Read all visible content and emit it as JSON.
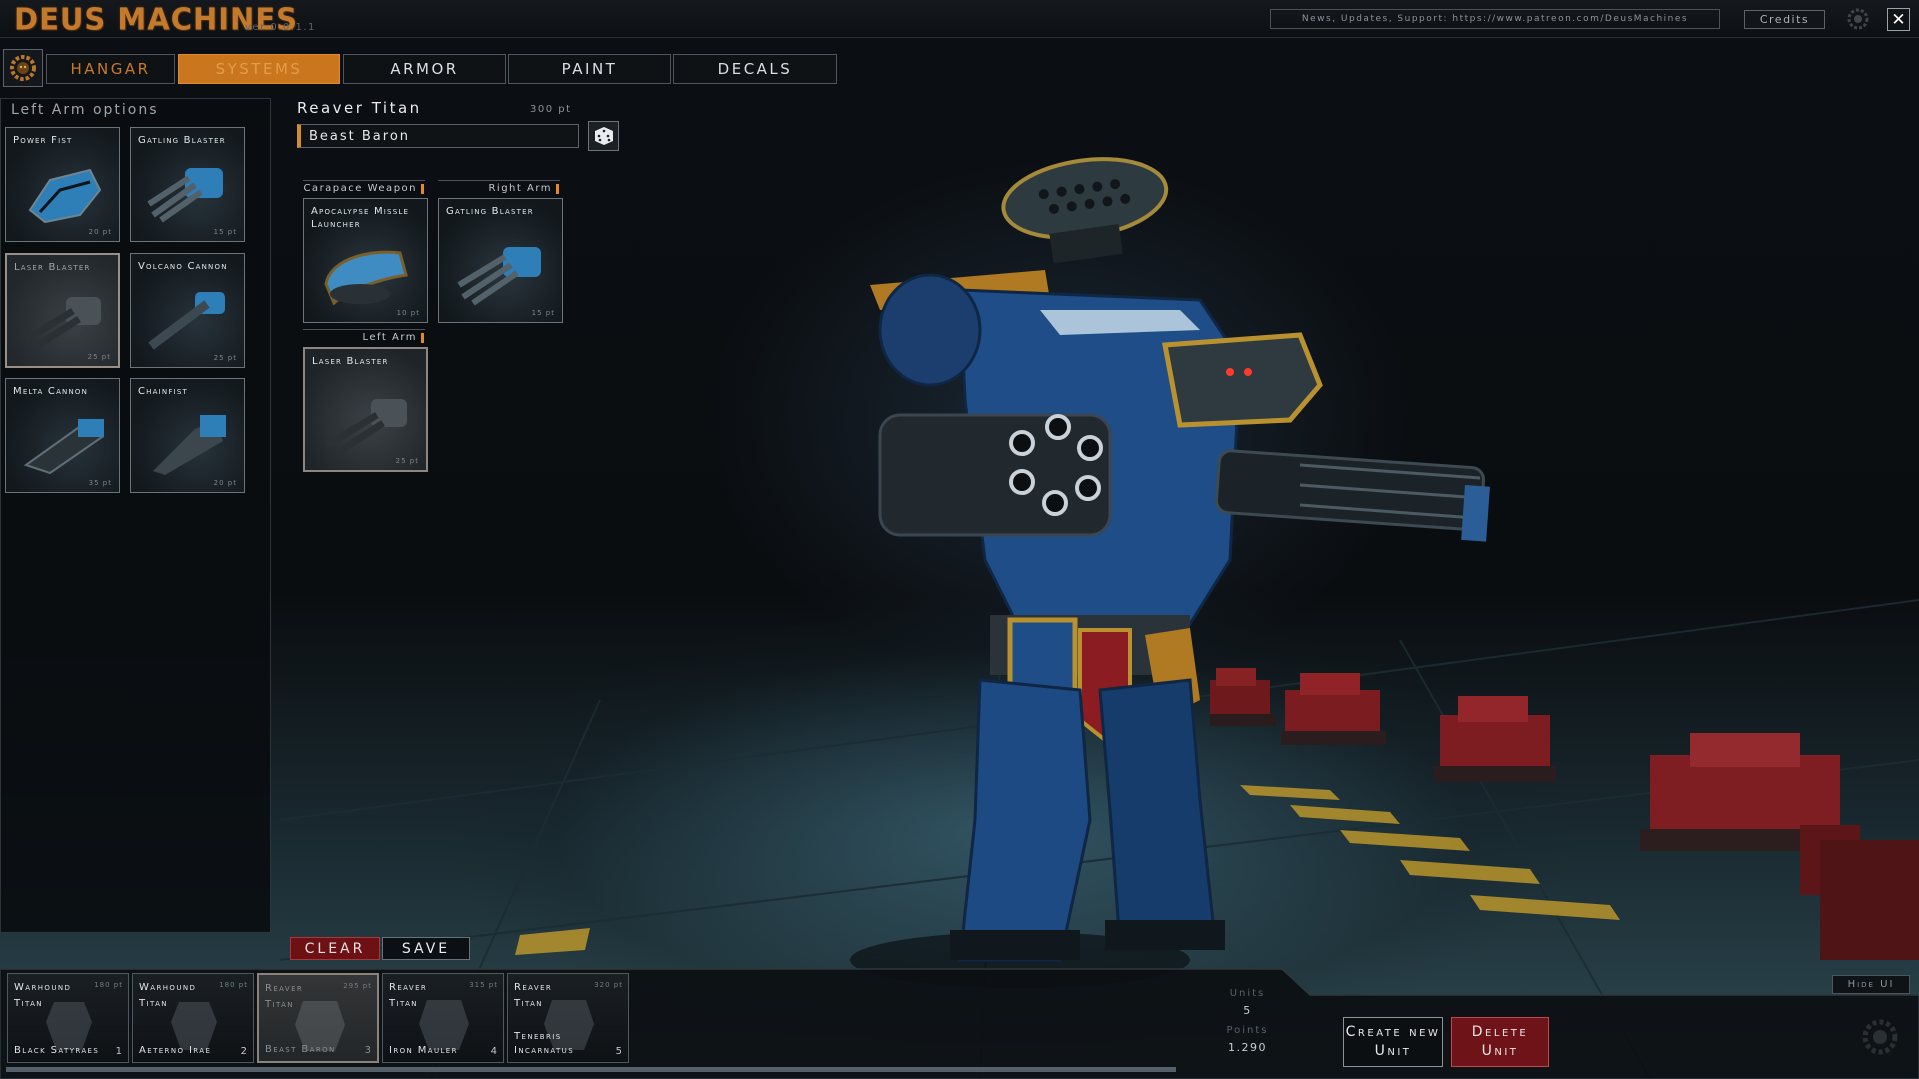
{
  "app": {
    "title": "DEUS MACHINES",
    "version": "ver:0.0.1.1",
    "news": "News, Updates, Support: https://www.patreon.com/DeusMachines",
    "credits_label": "Credits",
    "close_label": "✕"
  },
  "tabs": [
    {
      "label": "HANGAR"
    },
    {
      "label": "SYSTEMS"
    },
    {
      "label": "ARMOR"
    },
    {
      "label": "PAINT"
    },
    {
      "label": "DECALS"
    }
  ],
  "options_panel": {
    "title": "Left Arm options",
    "items": [
      {
        "name": "Power Fist",
        "points": "20 pt",
        "icon": "power-fist-icon"
      },
      {
        "name": "Gatling Blaster",
        "points": "15 pt",
        "icon": "gatling-blaster-icon"
      },
      {
        "name": "Laser Blaster",
        "points": "25 pt",
        "icon": "laser-blaster-icon"
      },
      {
        "name": "Volcano Cannon",
        "points": "25 pt",
        "icon": "volcano-cannon-icon"
      },
      {
        "name": "Melta Cannon",
        "points": "35 pt",
        "icon": "melta-cannon-icon"
      },
      {
        "name": "Chainfist",
        "points": "20 pt",
        "icon": "chainfist-icon"
      }
    ],
    "selected_index": 2
  },
  "unit": {
    "title": "Reaver Titan",
    "points": "300 pt",
    "name_value": "Beast Baron"
  },
  "slots": [
    {
      "label": "Carapace Weapon",
      "item": "Apocalypse Missle Launcher",
      "points": "10 pt"
    },
    {
      "label": "Right Arm",
      "item": "Gatling Blaster",
      "points": "15 pt"
    },
    {
      "label": "Left Arm",
      "item": "Laser Blaster",
      "points": "25 pt"
    }
  ],
  "actions": {
    "clear_label": "CLEAR",
    "save_label": "SAVE"
  },
  "roster": [
    {
      "type": "Warhound Titan",
      "points": "180 pt",
      "name": "Black Satyraes",
      "number": "1"
    },
    {
      "type": "Warhound Titan",
      "points": "180 pt",
      "name": "Aeterno Irae",
      "number": "2"
    },
    {
      "type": "Reaver Titan",
      "points": "295 pt",
      "name": "Beast Baron",
      "number": "3"
    },
    {
      "type": "Reaver Titan",
      "points": "315 pt",
      "name": "Iron Mauler",
      "number": "4"
    },
    {
      "type": "Reaver Titan",
      "points": "320 pt",
      "name": "Tenebris Incarnatus",
      "number": "5"
    }
  ],
  "roster_selected_index": 2,
  "stats": {
    "units_label": "Units",
    "units_value": "5",
    "points_label": "Points",
    "points_value": "1.290"
  },
  "bottom_actions": {
    "create_label": "Create new Unit",
    "delete_label": "Delete Unit",
    "hide_ui_label": "Hide UI"
  },
  "colors": {
    "accent_orange": "#c9761f",
    "danger_red": "#6e1418",
    "titan_blue": "#1f4d87",
    "titan_gold": "#b9922f"
  }
}
